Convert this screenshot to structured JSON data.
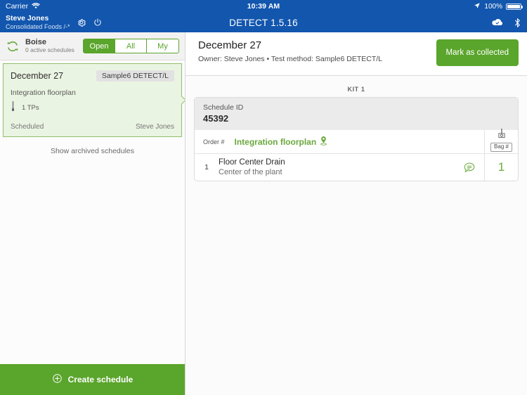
{
  "statusbar": {
    "carrier": "Carrier",
    "wifi_icon": "wifi-icon",
    "time": "10:39 AM",
    "location_icon": "location-arrow-icon",
    "battery_percent": "100%",
    "battery_icon": "battery-full-icon"
  },
  "navbar": {
    "user_name": "Steve Jones",
    "user_org": "Consolidated Foods /-*",
    "settings_icon": "gear-icon",
    "power_icon": "power-icon",
    "title": "DETECT 1.5.16",
    "cloud_icon": "cloud-check-icon",
    "bluetooth_icon": "bluetooth-icon"
  },
  "sidebar": {
    "refresh_icon": "refresh-icon",
    "location_name": "Boise",
    "location_sub": "0 active schedules",
    "filters": [
      {
        "label": "Open",
        "active": true
      },
      {
        "label": "All",
        "active": false
      },
      {
        "label": "My",
        "active": false
      }
    ],
    "schedule_card": {
      "date": "December 27",
      "badge": "Sample6 DETECT/L",
      "floorplan": "Integration floorplan",
      "tp_icon": "swab-icon",
      "tp_count": "1 TPs",
      "status": "Scheduled",
      "owner": "Steve Jones"
    },
    "archived_link": "Show archived schedules",
    "create_icon": "plus-circle-icon",
    "create_label": "Create schedule"
  },
  "main": {
    "title": "December 27",
    "subtitle": "Owner: Steve Jones • Test method: Sample6 DETECT/L",
    "collect_button": "Mark as collected",
    "kit_label": "KIT 1",
    "schedule_id_label": "Schedule ID",
    "schedule_id_value": "45392",
    "order_header": "Order #",
    "floorplan_link": "Integration floorplan",
    "floorplan_pin_icon": "map-pin-icon",
    "bag_icon": "swab-bag-icon",
    "bag_label": "Bag #",
    "rows": [
      {
        "order": "1",
        "name": "Floor Center Drain",
        "description": "Center of the plant",
        "comment_icon": "comment-bubble-icon",
        "bag_number": "1"
      }
    ]
  },
  "colors": {
    "brand_blue": "#1256ae",
    "brand_green": "#5aa52b",
    "link_green": "#6aa83c",
    "card_green_bg": "#eaf4e2"
  }
}
